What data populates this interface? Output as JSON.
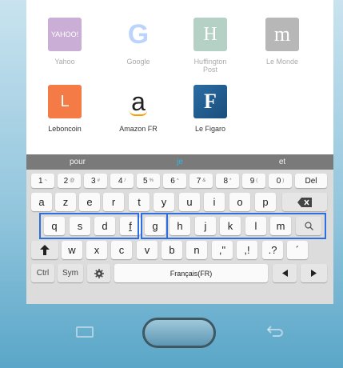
{
  "apps": [
    {
      "name": "Yahoo",
      "tile_text": "YAHOO!",
      "color": "#6a1a8c"
    },
    {
      "name": "Google",
      "tile_text": "G",
      "color": "#4285f4"
    },
    {
      "name": "Huffington Post",
      "tile_text": "H",
      "color": "#2e7b5b"
    },
    {
      "name": "Le Monde",
      "tile_text": "m",
      "color": "#333333"
    },
    {
      "name": "Leboncoin",
      "tile_text": "L",
      "color": "#f46b2f"
    },
    {
      "name": "Amazon FR",
      "tile_text": "a",
      "color": "#222222"
    },
    {
      "name": "Le Figaro",
      "tile_text": "F",
      "color": "#1b4e7a"
    }
  ],
  "suggestions": [
    "pour",
    "je",
    "et"
  ],
  "number_row": [
    {
      "main": "1",
      "sup": "~"
    },
    {
      "main": "2",
      "sup": "@"
    },
    {
      "main": "3",
      "sup": "#"
    },
    {
      "main": "4",
      "sup": "/"
    },
    {
      "main": "5",
      "sup": "%"
    },
    {
      "main": "6",
      "sup": "^"
    },
    {
      "main": "7",
      "sup": "&"
    },
    {
      "main": "8",
      "sup": "*"
    },
    {
      "main": "9",
      "sup": "("
    },
    {
      "main": "0",
      "sup": ")"
    },
    {
      "main": "Del",
      "sup": ""
    }
  ],
  "row_azerty": [
    "a",
    "z",
    "e",
    "r",
    "t",
    "y",
    "u",
    "i",
    "o",
    "p"
  ],
  "row_home": [
    "q",
    "s",
    "d",
    "f",
    "g",
    "h",
    "j",
    "k",
    "l",
    "m"
  ],
  "row_bottom": [
    "w",
    "x",
    "c",
    "v",
    "b",
    "n",
    ",\"",
    ",!",
    ".?",
    "´"
  ],
  "function_row": {
    "ctrl": "Ctrl",
    "sym": "Sym",
    "space": "Français(FR)"
  },
  "colors": {
    "highlight": "#2e6fe0",
    "suggestion_active": "#2eb8e6"
  }
}
